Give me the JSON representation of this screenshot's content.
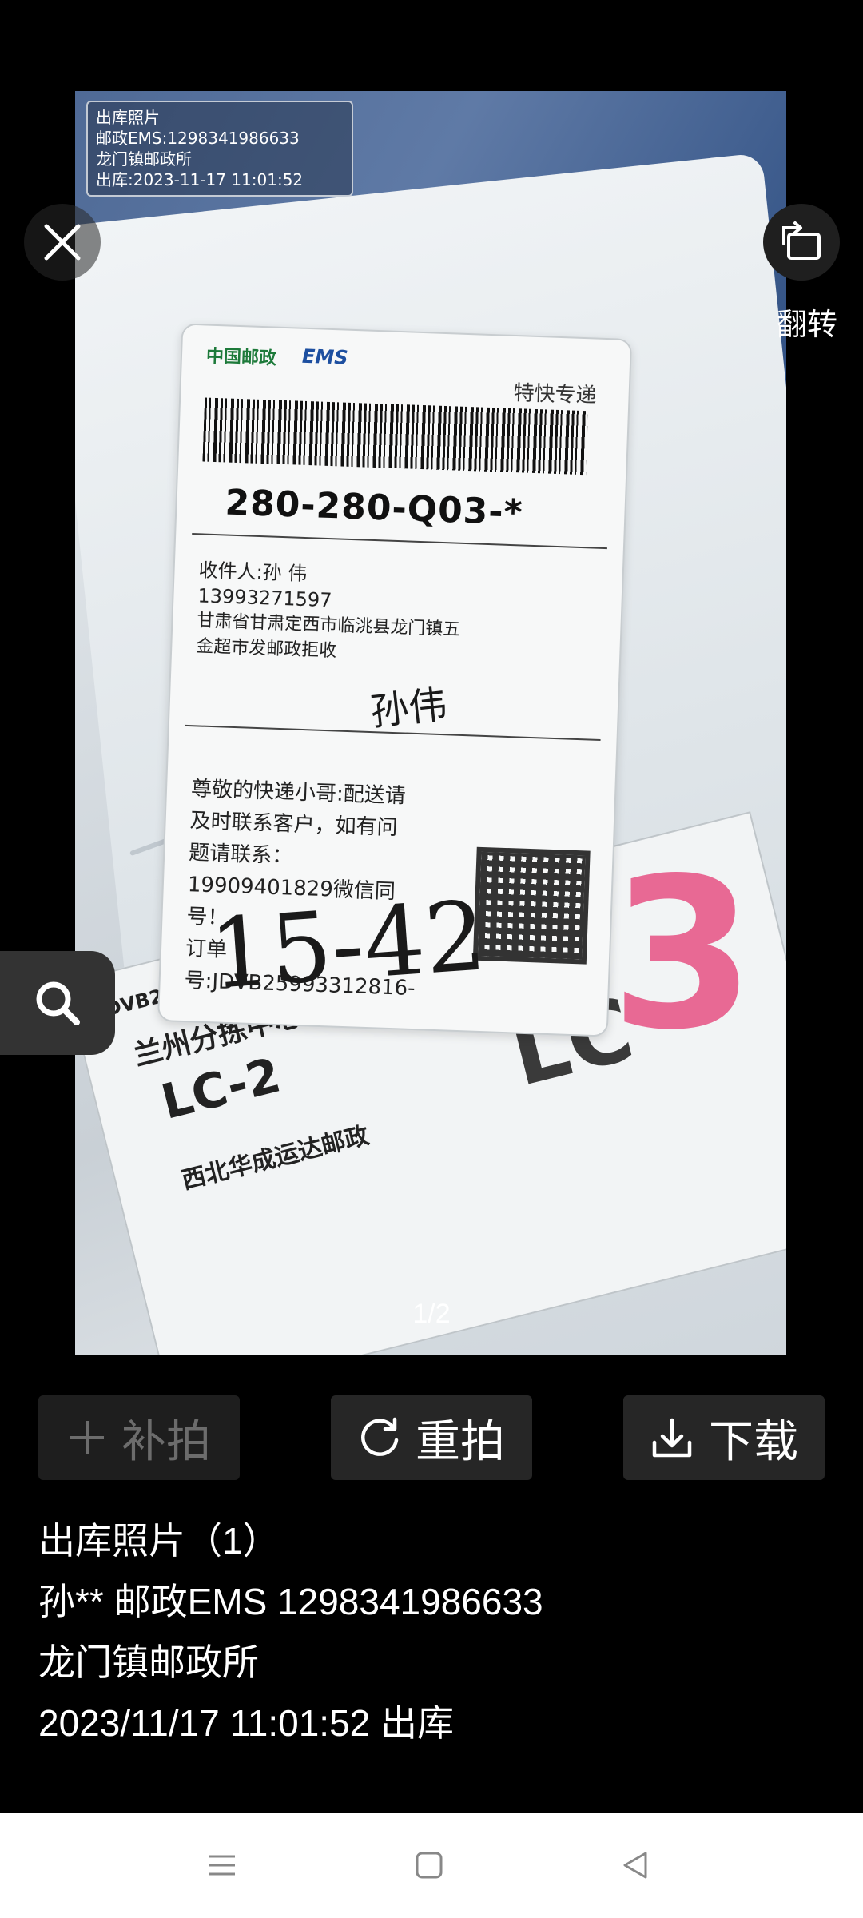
{
  "photo": {
    "watermark": {
      "line1": "出库照片",
      "line2": "邮政EMS:1298341986633",
      "line3": "龙门镇邮政所",
      "line4": "出库:2023-11-17 11:01:52"
    },
    "label_ems": {
      "brand": "中国邮政",
      "brand_ems": "EMS",
      "service": "特快专递",
      "route_code": "280-280-Q03-*",
      "recipient_line1": "收件人:孙 伟",
      "recipient_phone": "13993271597",
      "address_line1": "甘肃省甘肃定西市临洮县龙门镇五",
      "address_line2": "金超市发邮政拒收",
      "note_line1": "尊敬的快递小哥:配送请",
      "note_line2": "及时联系客户，如有问",
      "note_line3": "题请联系：",
      "note_line4": "19909401829微信同",
      "note_line5": "号！",
      "note_line6": "订单",
      "note_line7": "号:JDVB25993312816-",
      "handwriting_sig": "孙伟",
      "handwriting_num": "15-42"
    },
    "label_2": {
      "code": "JDVB2599331",
      "center": "兰州分拣中心",
      "lc": "LC-2",
      "company": "西北华成运达邮政",
      "big_lc": "LC",
      "pink_number": "3"
    },
    "page_indicator": "1/2"
  },
  "controls": {
    "close_icon": "close-icon",
    "rotate_icon": "rotate-icon",
    "rotate_label": "翻转",
    "zoom_icon": "search-icon"
  },
  "actions": {
    "add_label": "补拍",
    "retake_label": "重拍",
    "download_label": "下载"
  },
  "info": {
    "line1": "出库照片（1）",
    "line2": "孙**  邮政EMS  1298341986633",
    "line3": "龙门镇邮政所",
    "line4": "2023/11/17 11:01:52  出库"
  },
  "navbar": {
    "menu_icon": "menu-icon",
    "home_icon": "square-home-icon",
    "back_icon": "triangle-back-icon"
  },
  "colors": {
    "background": "#000000",
    "button_bg": "#262626",
    "disabled_text": "#6c6c6c",
    "pink_mark": "#e65082",
    "navbar_bg": "#ffffff"
  }
}
